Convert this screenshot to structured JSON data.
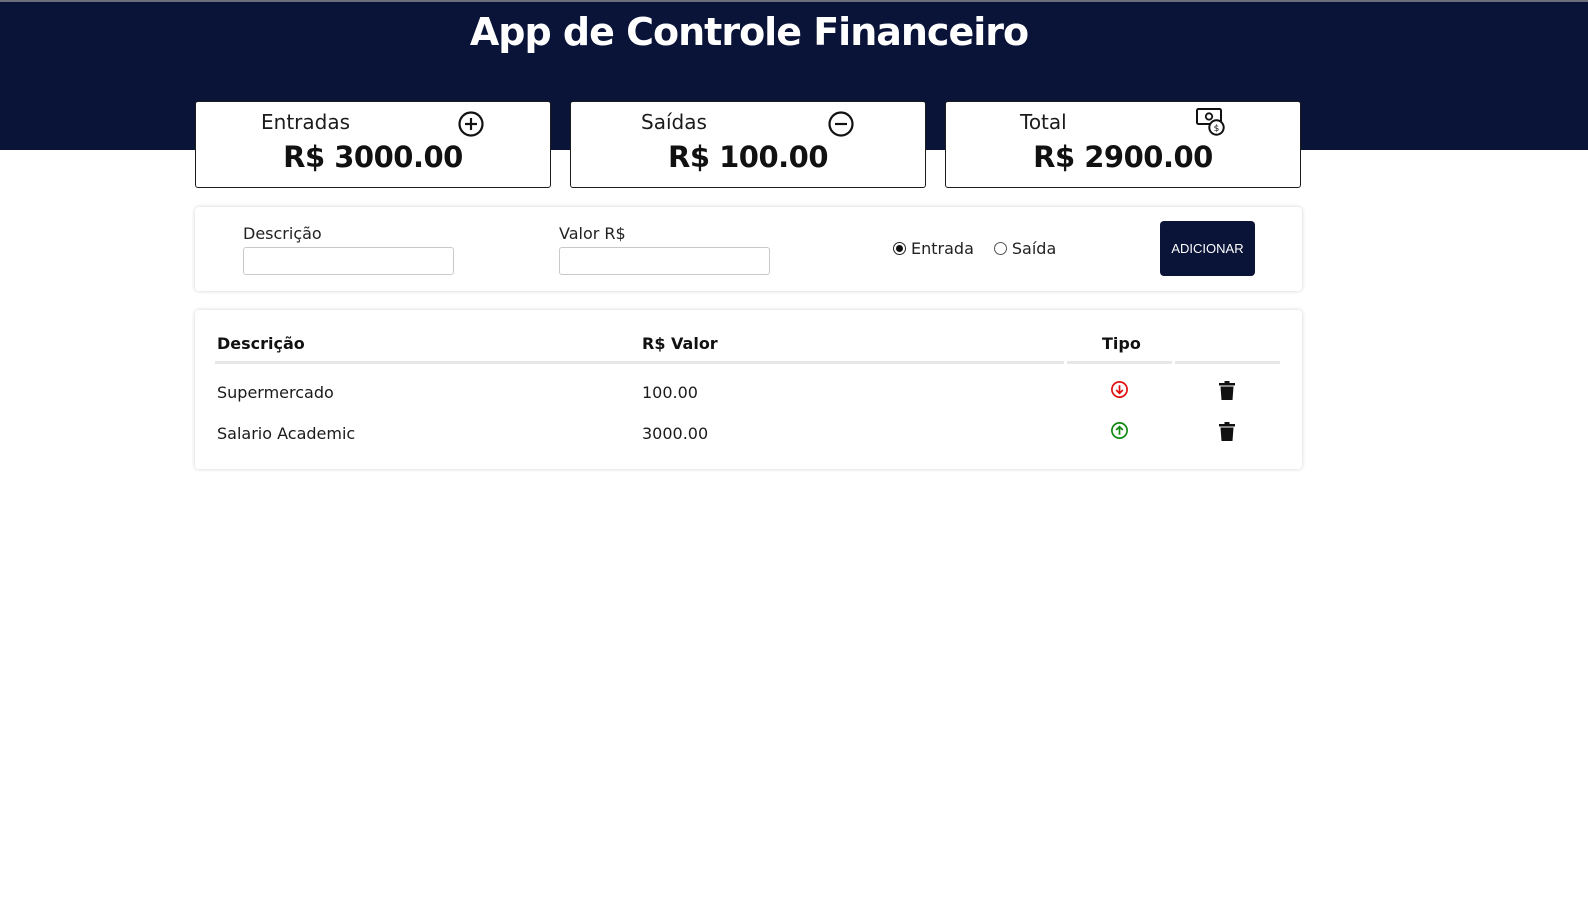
{
  "app": {
    "title": "App de Controle Financeiro"
  },
  "summary": {
    "entradas": {
      "label": "Entradas",
      "value": "R$ 3000.00",
      "icon": "plus-circle-icon"
    },
    "saidas": {
      "label": "Saídas",
      "value": "R$ 100.00",
      "icon": "minus-circle-icon"
    },
    "total": {
      "label": "Total",
      "value": "R$ 2900.00",
      "icon": "money-bill-icon"
    }
  },
  "form": {
    "descricao_label": "Descrição",
    "descricao_value": "",
    "valor_label": "Valor R$",
    "valor_value": "",
    "radio_entrada": "Entrada",
    "radio_saida": "Saída",
    "selected_type": "Entrada",
    "add_button": "ADICIONAR"
  },
  "table": {
    "headers": [
      "Descrição",
      "R$ Valor",
      "Tipo",
      ""
    ],
    "rows": [
      {
        "descricao": "Supermercado",
        "valor": "100.00",
        "tipo": "saida",
        "tipo_icon": "arrow-down-circle-icon"
      },
      {
        "descricao": "Salario Academic",
        "valor": "3000.00",
        "tipo": "entrada",
        "tipo_icon": "arrow-up-circle-icon"
      }
    ]
  },
  "colors": {
    "header_bg": "#0a1338",
    "button_bg": "#0a1338",
    "saida_icon": "#e01010",
    "entrada_icon": "#108a10"
  }
}
